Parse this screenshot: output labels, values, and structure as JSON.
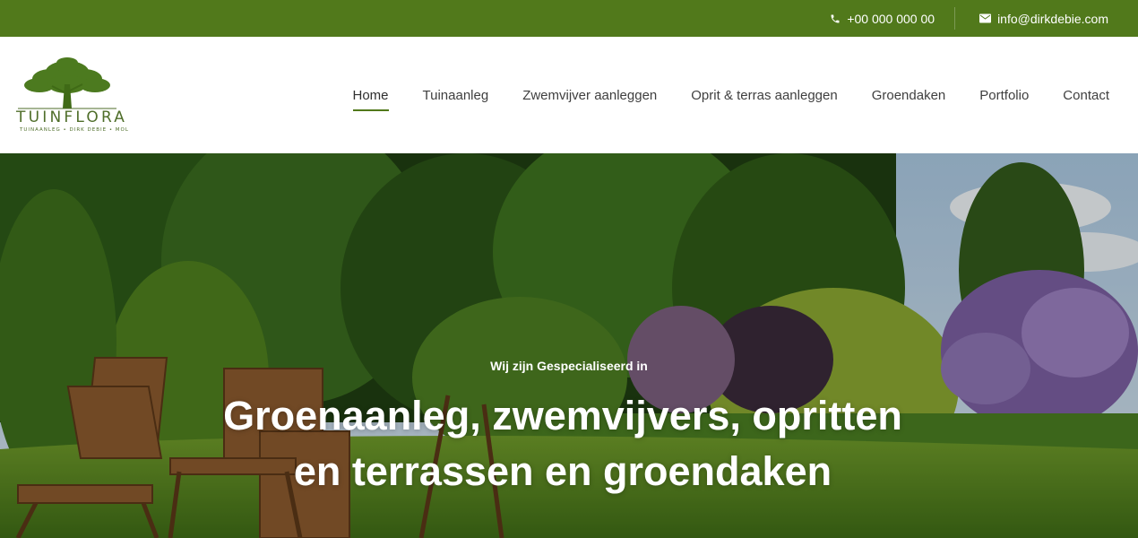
{
  "topbar": {
    "phone": "+00 000 000 00",
    "email": "info@dirkdebie.com",
    "background": "#51791b"
  },
  "logo": {
    "brand": "TUINFLORA",
    "tagline": "TUINAANLEG • DIRK DEBIE • MOL",
    "color": "#4f6e2a"
  },
  "nav": {
    "items": [
      {
        "label": "Home",
        "active": true
      },
      {
        "label": "Tuinaanleg"
      },
      {
        "label": "Zwemvijver aanleggen"
      },
      {
        "label": "Oprit & terras aanleggen"
      },
      {
        "label": "Groendaken"
      },
      {
        "label": "Portfolio"
      },
      {
        "label": "Contact"
      }
    ]
  },
  "hero": {
    "kicker": "Wij zijn Gespecialiseerd in",
    "headline_line1": "Groenaanleg, zwemvijvers, opritten",
    "headline_line2": "en terrassen en groendaken"
  },
  "icons": {
    "phone": "phone-icon",
    "email": "envelope-icon",
    "logo": "tree-icon"
  }
}
